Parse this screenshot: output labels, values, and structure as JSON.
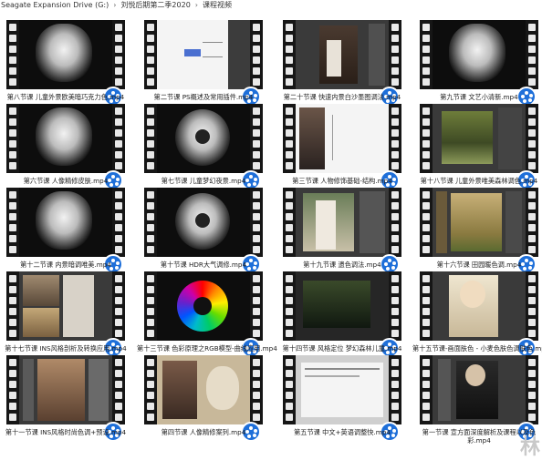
{
  "breadcrumb": [
    "Seagate Expansion Drive (G:)",
    "刘悦后期第二季2020",
    "课程视频"
  ],
  "files": [
    {
      "name": "第八节课 儿童外景欧美暗巧克力色.mp4",
      "thumb": "smoke"
    },
    {
      "name": "第二节课 PS概述及常用插件.mp4",
      "thumb": "ps-diagram"
    },
    {
      "name": "第二十节课 快速内景白沙墨图调法.mp4",
      "thumb": "wedding"
    },
    {
      "name": "第九节课 文艺小清新.mp4",
      "thumb": "smoke"
    },
    {
      "name": "第六节课 人像精修皮肤.mp4",
      "thumb": "smoke"
    },
    {
      "name": "第七节课 儿童梦幻夜景.mp4",
      "thumb": "smoke-ring"
    },
    {
      "name": "第三节课 人物修饰基础-结构.mp4",
      "thumb": "portrait-diagram"
    },
    {
      "name": "第十八节课 儿童外景唯美森林调色.mp4",
      "thumb": "forest"
    },
    {
      "name": "第十二节课 内景暗调唯美.mp4",
      "thumb": "smoke"
    },
    {
      "name": "第十节课 HDR大气调修.mp4",
      "thumb": "smoke-ring"
    },
    {
      "name": "第十九节课 遗色调法.mp4",
      "thumb": "couple"
    },
    {
      "name": "第十六节课 田园暖色调.mp4",
      "thumb": "field"
    },
    {
      "name": "第十七节课 INS风格剖析及转换应用.mp4",
      "thumb": "ins"
    },
    {
      "name": "第十三节课 色彩原理之RGB模型-曲线应用.mp4",
      "thumb": "color-wheel"
    },
    {
      "name": "第十四节课 风格定位 梦幻森林儿童.mp4",
      "thumb": "dark-forest"
    },
    {
      "name": "第十五节课-画面肤色 - 小麦色肤色调肤色.mp4",
      "thumb": "blonde"
    },
    {
      "name": "第十一节课 INS风格时尚色调+预设.mp4",
      "thumb": "ins-couple"
    },
    {
      "name": "第四节课 人像精修案列.mp4",
      "thumb": "skull"
    },
    {
      "name": "第五节课 中文+英语调整快.mp4",
      "thumb": "screenshot"
    },
    {
      "name": "第一节课 宣方面深度解析及课程以及色彩.mp4",
      "thumb": "woman-dark"
    }
  ],
  "watermark": "林"
}
